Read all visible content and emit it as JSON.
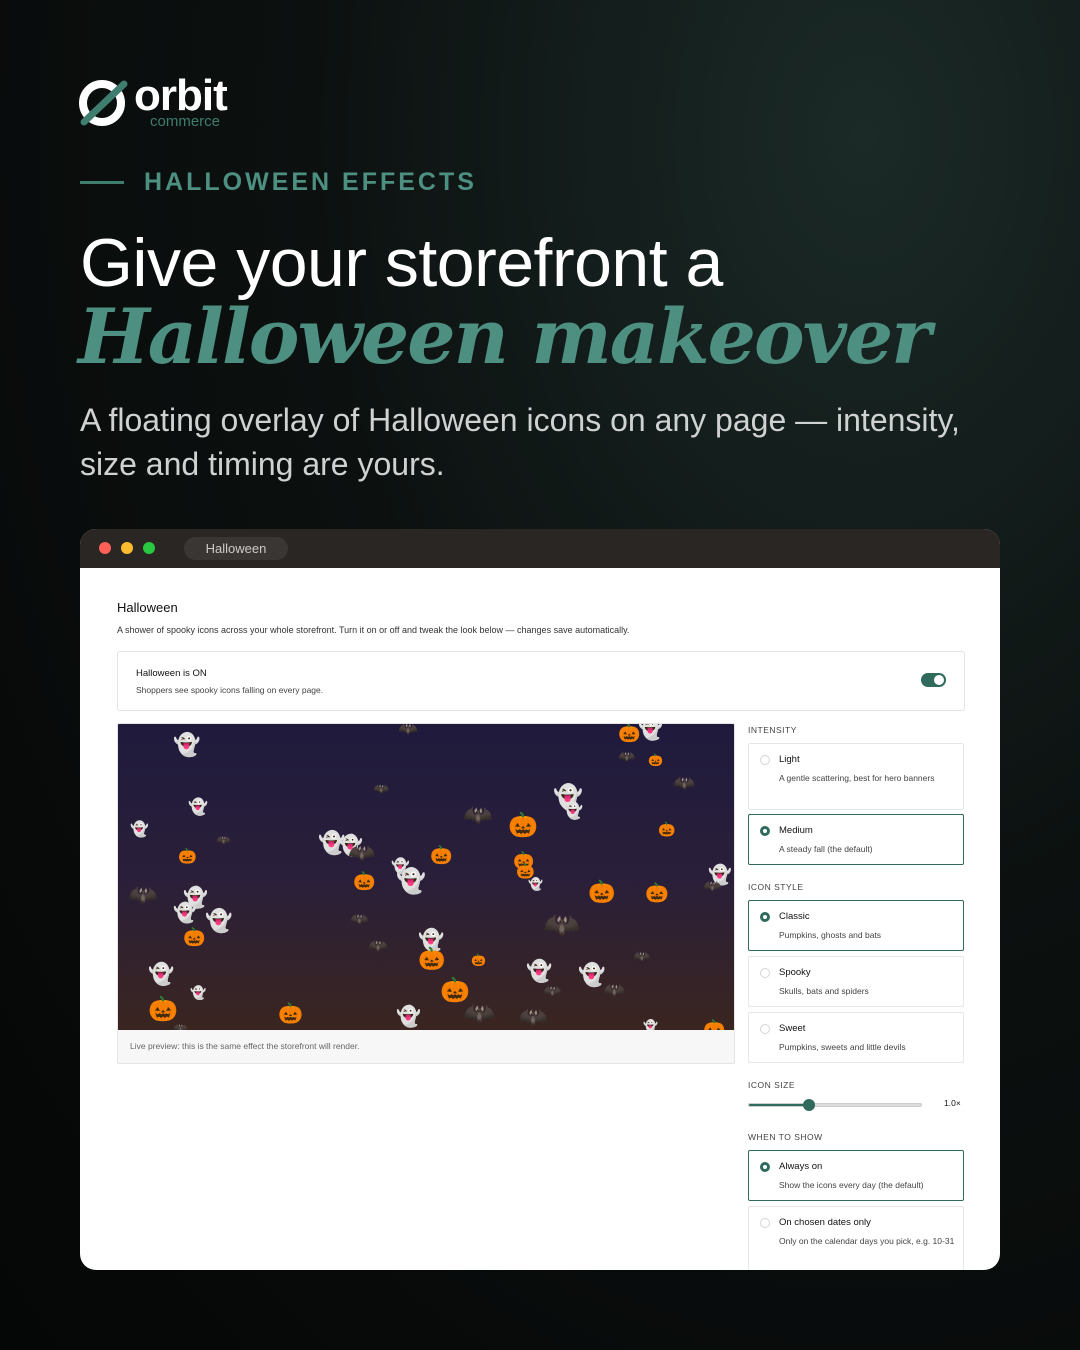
{
  "brand": {
    "name": "orbit",
    "sub": "commerce"
  },
  "eyebrow": "HALLOWEEN EFFECTS",
  "headline": {
    "line1": "Give your storefront  a",
    "line2": "Halloween makeover"
  },
  "subtitle": "A floating overlay of Halloween icons on any page — intensity, size and timing are yours.",
  "colors": {
    "accent": "#3f7d6f",
    "control": "#2f6a5c"
  },
  "window": {
    "tab_label": "Halloween",
    "page_title": "Halloween",
    "page_desc": "A shower of spooky icons across your whole storefront. Turn it on or off and tweak the look below — changes save automatically.",
    "status": {
      "title": "Halloween is ON",
      "desc": "Shoppers see spooky icons falling on every page.",
      "enabled": true
    },
    "preview_caption": "Live preview: this is the same effect the storefront will render.",
    "intensity": {
      "label": "INTENSITY",
      "options": [
        {
          "title": "Light",
          "desc": "A gentle scattering, best for hero banners",
          "selected": false
        },
        {
          "title": "Medium",
          "desc": "A steady fall (the default)",
          "selected": true
        }
      ]
    },
    "icon_style": {
      "label": "ICON STYLE",
      "options": [
        {
          "title": "Classic",
          "desc": "Pumpkins, ghosts and bats",
          "selected": true
        },
        {
          "title": "Spooky",
          "desc": "Skulls, bats and spiders",
          "selected": false
        },
        {
          "title": "Sweet",
          "desc": "Pumpkins, sweets and little devils",
          "selected": false
        }
      ]
    },
    "icon_size": {
      "label": "ICON SIZE",
      "value_label": "1.0×",
      "fraction": 0.35
    },
    "when_to_show": {
      "label": "WHEN TO SHOW",
      "options": [
        {
          "title": "Always on",
          "desc": "Show the icons every day (the default)",
          "selected": true
        },
        {
          "title": "On chosen dates only",
          "desc": "Only on the calendar days you pick, e.g. 10-31",
          "selected": false
        }
      ]
    }
  },
  "preview_icons": {
    "ghost": "👻",
    "pumpkin": "🎃",
    "bat": "🦇"
  }
}
